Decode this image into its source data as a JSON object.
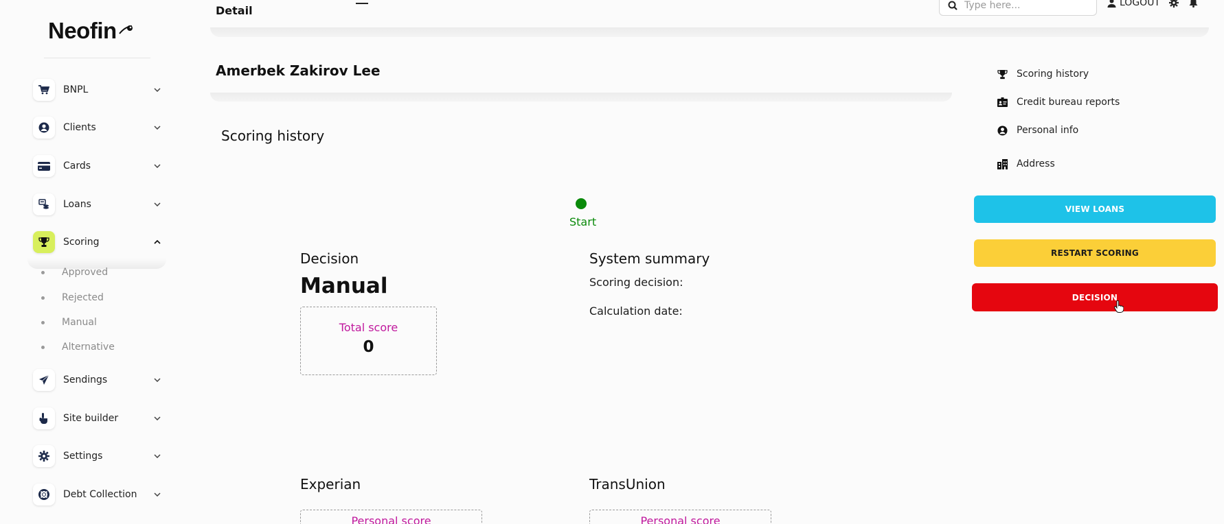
{
  "brand": {
    "name": "Neofin"
  },
  "sidebar": {
    "items": [
      {
        "label": "BNPL",
        "icon": "cart-icon"
      },
      {
        "label": "Clients",
        "icon": "user-circle-icon"
      },
      {
        "label": "Cards",
        "icon": "credit-card-icon"
      },
      {
        "label": "Loans",
        "icon": "loans-icon"
      },
      {
        "label": "Scoring",
        "icon": "trophy-icon",
        "active": true
      },
      {
        "label": "Sendings",
        "icon": "paper-plane-icon"
      },
      {
        "label": "Site builder",
        "icon": "hand-pointer-icon"
      },
      {
        "label": "Settings",
        "icon": "gear-icon"
      },
      {
        "label": "Debt Collection",
        "icon": "lifebuoy-icon"
      }
    ],
    "scoring_subitems": [
      "Approved",
      "Rejected",
      "Manual",
      "Alternative"
    ]
  },
  "topbar": {
    "title": "Detail",
    "search_placeholder": "Type here...",
    "logout_label": "LOGOUT"
  },
  "client": {
    "name": "Amerbek Zakirov Lee"
  },
  "scoring": {
    "section_title": "Scoring history",
    "start_label": "Start",
    "decision_heading": "Decision",
    "decision_value": "Manual",
    "total_score_label": "Total score",
    "total_score_value": "0",
    "summary_heading": "System summary",
    "scoring_decision_label": "Scoring decision:",
    "calculation_date_label": "Calculation date:",
    "experian_heading": "Experian",
    "transunion_heading": "TransUnion",
    "personal_score_label": "Personal score"
  },
  "right_panel": {
    "links": [
      "Scoring history",
      "Credit bureau reports",
      "Personal info",
      "Address"
    ],
    "view_loans_label": "VIEW LOANS",
    "restart_scoring_label": "RESTART SCORING",
    "decision_label": "DECISION"
  },
  "colors": {
    "accent_green": "#0a8a0a",
    "score_label_magenta": "#c0189d",
    "btn_cyan": "#1ec2e8",
    "btn_yellow": "#fbcf38",
    "btn_red": "#e5060f",
    "active_nav": "#d8ef5c"
  }
}
